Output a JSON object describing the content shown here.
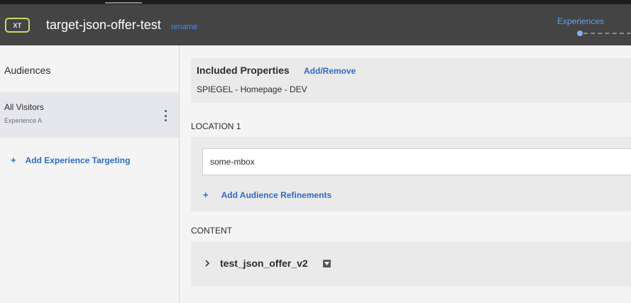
{
  "header": {
    "badge": "XT",
    "activity_name": "target-json-offer-test",
    "rename_label": "rename",
    "step_label": "Experiences"
  },
  "left_panel": {
    "title": "Audiences",
    "audience": {
      "name": "All Visitors",
      "experience": "Experience A"
    },
    "add_targeting_label": "Add Experience Targeting",
    "plus_glyph": "+"
  },
  "main": {
    "properties": {
      "title": "Included Properties",
      "action_label": "Add/Remove",
      "value": "SPIEGEL - Homepage - DEV"
    },
    "location": {
      "label": "LOCATION 1",
      "mbox_value": "some-mbox",
      "add_refinements_label": "Add Audience Refinements"
    },
    "content": {
      "label": "CONTENT",
      "offer_name": "test_json_offer_v2"
    }
  },
  "icons": {
    "kebab": "kebab-menu-icon",
    "chevron": "chevron-right-icon",
    "dropdown": "caret-down-icon"
  },
  "colors": {
    "header_bg": "#444444",
    "accent_blue": "#2d6cc4",
    "badge_border": "#c9d86a",
    "step_active": "#5ea2ee"
  }
}
